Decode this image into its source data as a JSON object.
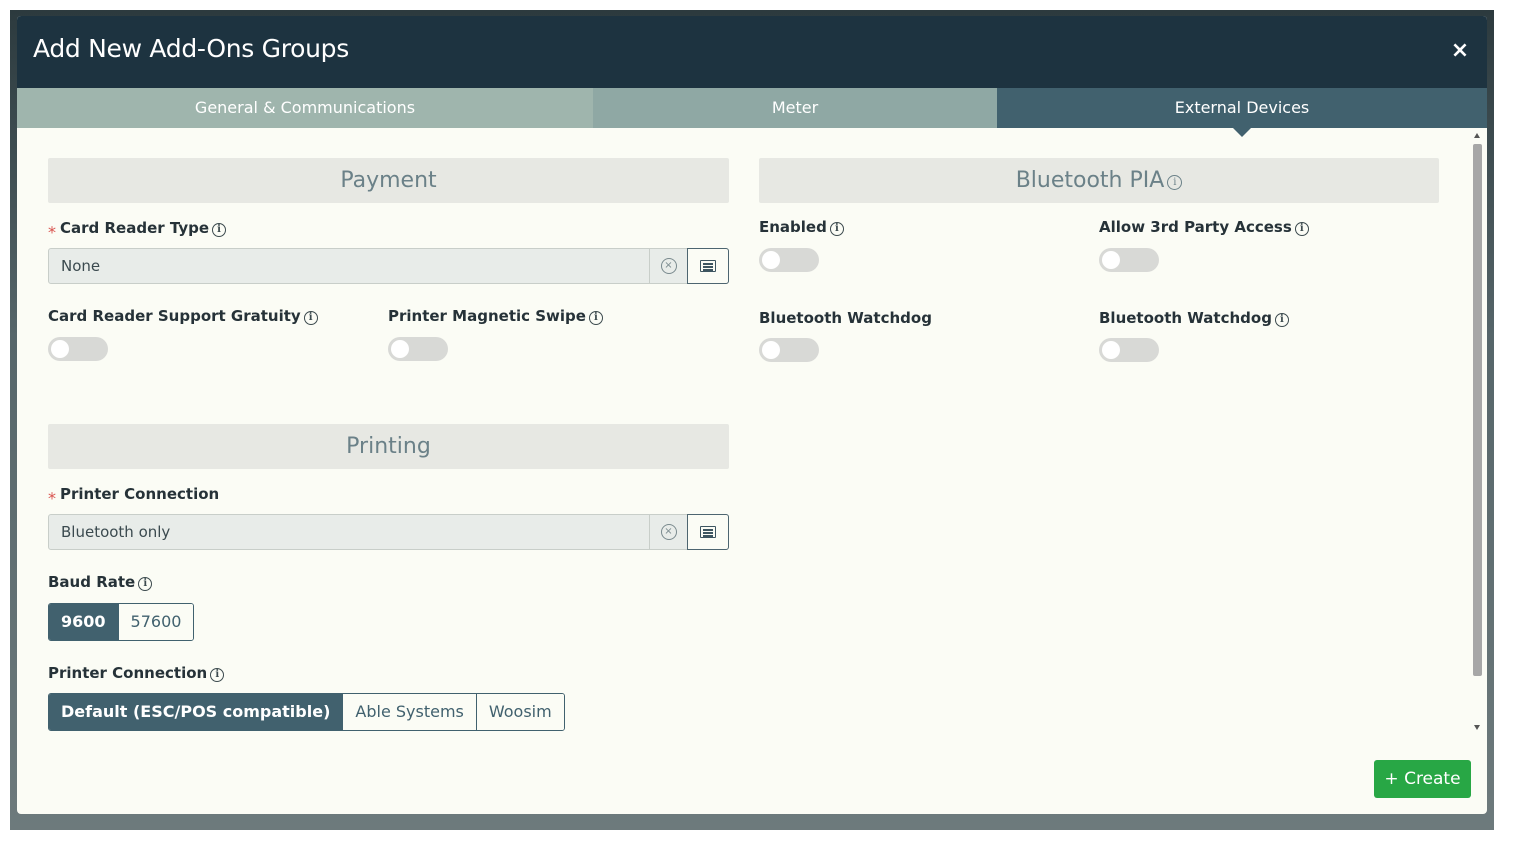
{
  "modal": {
    "title": "Add New Add-Ons Groups",
    "close_glyph": "×"
  },
  "tabs": [
    {
      "label": "General & Communications",
      "active": false
    },
    {
      "label": "Meter",
      "active": false
    },
    {
      "label": "External Devices",
      "active": true
    }
  ],
  "payment": {
    "header": "Payment",
    "card_reader_type": {
      "label": "Card Reader Type",
      "required": true,
      "value": "None"
    },
    "card_reader_support_gratuity": {
      "label": "Card Reader Support Gratuity",
      "enabled": false
    },
    "printer_magnetic_swipe": {
      "label": "Printer Magnetic Swipe",
      "enabled": false
    }
  },
  "bluetooth": {
    "header": "Bluetooth PIA",
    "enabled": {
      "label": "Enabled",
      "enabled": false
    },
    "allow_3rd_party": {
      "label": "Allow 3rd Party Access",
      "enabled": false
    },
    "watchdog_1": {
      "label": "Bluetooth Watchdog",
      "enabled": false
    },
    "watchdog_2": {
      "label": "Bluetooth Watchdog",
      "enabled": false
    }
  },
  "printing": {
    "header": "Printing",
    "printer_connection_select": {
      "label": "Printer Connection",
      "required": true,
      "value": "Bluetooth only"
    },
    "baud_rate": {
      "label": "Baud Rate",
      "options": [
        "9600",
        "57600"
      ],
      "selected": "9600"
    },
    "printer_connection_type": {
      "label": "Printer Connection",
      "options": [
        "Default (ESC/POS compatible)",
        "Able Systems",
        "Woosim"
      ],
      "selected": "Default (ESC/POS compatible)"
    }
  },
  "footer": {
    "create_label": "+ Create"
  },
  "icons": {
    "info": "ⓘ",
    "clear": "×",
    "required": "⁎"
  },
  "colors": {
    "header_bg": "#1d3340",
    "tab_active": "#41616e",
    "create_btn": "#28a745"
  }
}
